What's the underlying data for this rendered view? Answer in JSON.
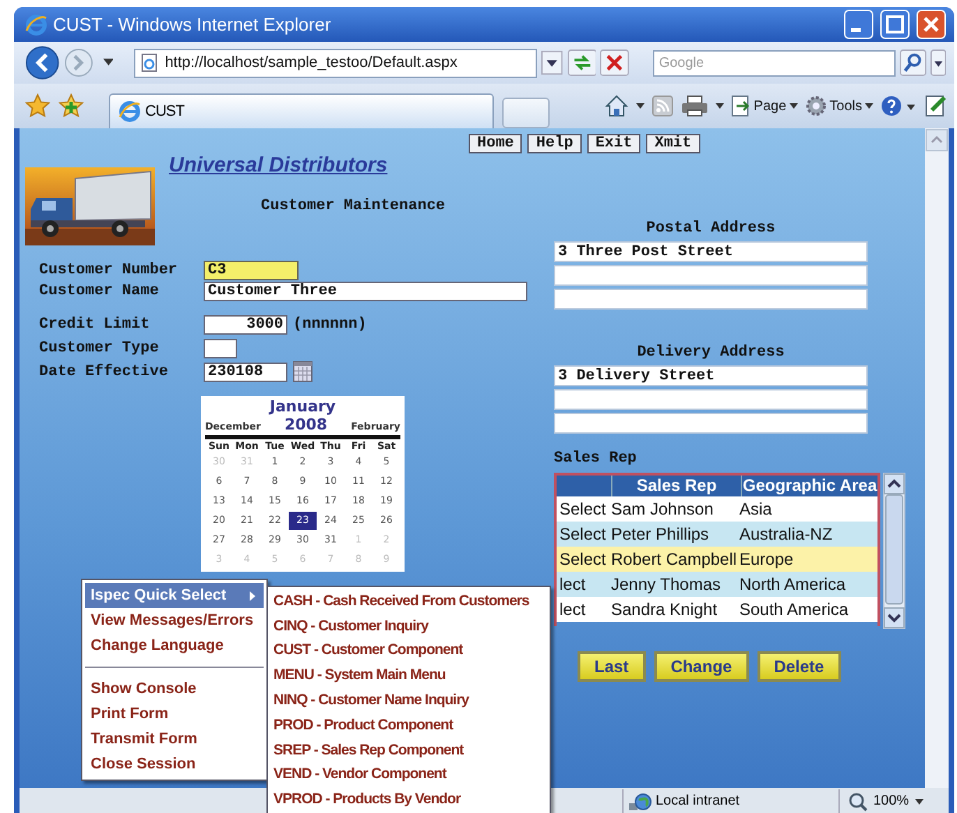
{
  "window": {
    "title": "CUST - Windows Internet Explorer"
  },
  "address_bar": {
    "url": "http://localhost/sample_testoo/Default.aspx"
  },
  "search": {
    "placeholder": "Google"
  },
  "tab": {
    "label": "CUST"
  },
  "toolbar": [
    {
      "kind": "page",
      "label": "Page"
    },
    {
      "kind": "tools",
      "label": "Tools"
    }
  ],
  "nav_buttons": [
    "Home",
    "Help",
    "Exit",
    "Xmit"
  ],
  "company_link": "Universal Distributors",
  "form_title": "Customer Maintenance",
  "fields": [
    {
      "label": "Customer Number",
      "value": "C3",
      "kind": "code",
      "focused": true
    },
    {
      "label": "Customer Name",
      "value": "Customer Three",
      "kind": "name",
      "focused": false
    },
    {
      "label": "Credit Limit",
      "value": "3000",
      "kind": "number",
      "hint": "(nnnnnn)",
      "focused": false
    },
    {
      "label": "Customer Type",
      "kind": "flag",
      "focused": false
    },
    {
      "label": "Date Effective",
      "value": "230108",
      "kind": "date",
      "focused": false
    }
  ],
  "calendar": {
    "month": "January",
    "year": "2008",
    "previous": "December",
    "next": "February",
    "weekdays": [
      "Sun",
      "Mon",
      "Tue",
      "Wed",
      "Thu",
      "Fri",
      "Sat"
    ],
    "weeks": [
      [
        {
          "day": "30",
          "other_month": true,
          "selected": false
        },
        {
          "day": "31",
          "other_month": true,
          "selected": false
        },
        {
          "day": "1",
          "other_month": false,
          "selected": false
        },
        {
          "day": "2",
          "other_month": false,
          "selected": false
        },
        {
          "day": "3",
          "other_month": false,
          "selected": false
        },
        {
          "day": "4",
          "other_month": false,
          "selected": false
        },
        {
          "day": "5",
          "other_month": false,
          "selected": false
        }
      ],
      [
        {
          "day": "6",
          "other_month": false,
          "selected": false
        },
        {
          "day": "7",
          "other_month": false,
          "selected": false
        },
        {
          "day": "8",
          "other_month": false,
          "selected": false
        },
        {
          "day": "9",
          "other_month": false,
          "selected": false
        },
        {
          "day": "10",
          "other_month": false,
          "selected": false
        },
        {
          "day": "11",
          "other_month": false,
          "selected": false
        },
        {
          "day": "12",
          "other_month": false,
          "selected": false
        }
      ],
      [
        {
          "day": "13",
          "other_month": false,
          "selected": false
        },
        {
          "day": "14",
          "other_month": false,
          "selected": false
        },
        {
          "day": "15",
          "other_month": false,
          "selected": false
        },
        {
          "day": "16",
          "other_month": false,
          "selected": false
        },
        {
          "day": "17",
          "other_month": false,
          "selected": false
        },
        {
          "day": "18",
          "other_month": false,
          "selected": false
        },
        {
          "day": "19",
          "other_month": false,
          "selected": false
        }
      ],
      [
        {
          "day": "20",
          "other_month": false,
          "selected": false
        },
        {
          "day": "21",
          "other_month": false,
          "selected": false
        },
        {
          "day": "22",
          "other_month": false,
          "selected": false
        },
        {
          "day": "23",
          "other_month": false,
          "selected": true
        },
        {
          "day": "24",
          "other_month": false,
          "selected": false
        },
        {
          "day": "25",
          "other_month": false,
          "selected": false
        },
        {
          "day": "26",
          "other_month": false,
          "selected": false
        }
      ],
      [
        {
          "day": "27",
          "other_month": false,
          "selected": false
        },
        {
          "day": "28",
          "other_month": false,
          "selected": false
        },
        {
          "day": "29",
          "other_month": false,
          "selected": false
        },
        {
          "day": "30",
          "other_month": false,
          "selected": false
        },
        {
          "day": "31",
          "other_month": false,
          "selected": false
        },
        {
          "day": "1",
          "other_month": true,
          "selected": false
        },
        {
          "day": "2",
          "other_month": true,
          "selected": false
        }
      ],
      [
        {
          "day": "3",
          "other_month": true,
          "selected": false
        },
        {
          "day": "4",
          "other_month": true,
          "selected": false
        },
        {
          "day": "5",
          "other_month": true,
          "selected": false
        },
        {
          "day": "6",
          "other_month": true,
          "selected": false
        },
        {
          "day": "7",
          "other_month": true,
          "selected": false
        },
        {
          "day": "8",
          "other_month": true,
          "selected": false
        },
        {
          "day": "9",
          "other_month": true,
          "selected": false
        }
      ]
    ]
  },
  "postal_address": {
    "heading": "Postal Address",
    "lines": [
      {
        "kind": "filled",
        "value": "3 Three Post Street"
      },
      {
        "kind": "blank"
      },
      {
        "kind": "blank"
      }
    ]
  },
  "delivery_address": {
    "heading": "Delivery Address",
    "lines": [
      {
        "kind": "filled",
        "value": "3 Delivery Street"
      },
      {
        "kind": "blank"
      },
      {
        "kind": "blank"
      }
    ]
  },
  "sales_rep": {
    "heading": "Sales Rep",
    "columns": [
      "Sales Rep",
      "Geographic Area"
    ],
    "rows": [
      {
        "link": "Select",
        "name": "Sam Johnson",
        "area": "Asia",
        "selected": false
      },
      {
        "link": "Select",
        "name": "Peter Phillips",
        "area": "Australia-NZ",
        "selected": false
      },
      {
        "link": "Select",
        "name": "Robert Campbell",
        "area": "Europe",
        "selected": true
      },
      {
        "link": "lect",
        "name": "Jenny Thomas",
        "area": "North America",
        "selected": false
      },
      {
        "link": "lect",
        "name": "Sandra Knight",
        "area": "South America",
        "selected": false
      }
    ]
  },
  "action_buttons": [
    "Last",
    "Change",
    "Delete"
  ],
  "context_menu": {
    "items": [
      {
        "kind": "submenu",
        "label": "Ispec Quick Select",
        "highlighted": true
      },
      {
        "kind": "item",
        "label": "View Messages/Errors",
        "highlighted": false
      },
      {
        "kind": "item",
        "label": "Change Language",
        "highlighted": false
      },
      {
        "kind": "separator"
      },
      {
        "kind": "item",
        "label": "Show Console",
        "highlighted": false
      },
      {
        "kind": "item",
        "label": "Print Form",
        "highlighted": false
      },
      {
        "kind": "item",
        "label": "Transmit Form",
        "highlighted": false
      },
      {
        "kind": "item",
        "label": "Close Session",
        "highlighted": false
      }
    ],
    "submenu": [
      "CASH - Cash Received From Customers",
      "CINQ - Customer Inquiry",
      "CUST - Customer Component",
      "MENU - System Main Menu",
      "NINQ - Customer Name Inquiry",
      "PROD - Product Component",
      "SREP - Sales Rep Component",
      "VEND - Vendor Component",
      "VPROD - Products By Vendor"
    ]
  },
  "status_bar": {
    "zone": "Local intranet",
    "zoom": "100%"
  }
}
